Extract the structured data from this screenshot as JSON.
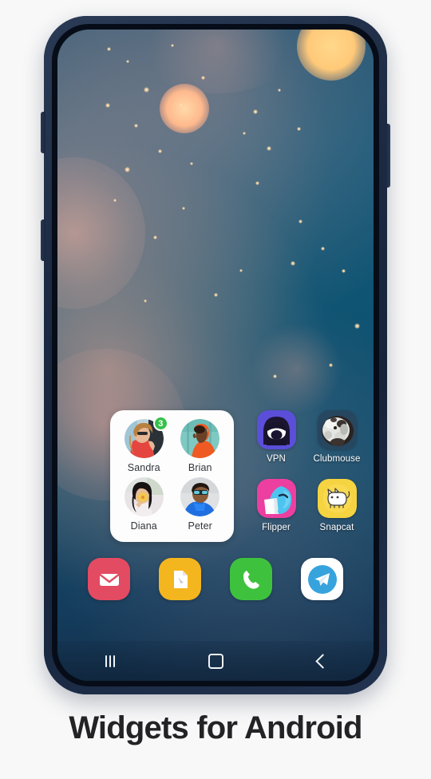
{
  "caption": {
    "text": "Widgets for Android"
  },
  "theme": {
    "page_background": "#f8f8f8",
    "phone_frame": "#1c2a43",
    "wallpaper_base": "#11506f",
    "badge_green": "#35c14a",
    "caption_color": "#232326",
    "widget_card": "#fdfdfd"
  },
  "phone": {
    "buttons": [
      {
        "name": "volume-up-button"
      },
      {
        "name": "volume-down-button"
      },
      {
        "name": "power-button"
      }
    ]
  },
  "home_screen": {
    "contacts_widget": {
      "name": "contacts-widget",
      "contacts": [
        {
          "name": "Sandra",
          "badge": "3",
          "badge_color": "#35c14a",
          "photo": "woman-sunglasses-red-dress"
        },
        {
          "name": "Brian",
          "badge": "",
          "badge_color": "",
          "photo": "man-orange-hoodie-profile"
        },
        {
          "name": "Diana",
          "badge": "",
          "badge_color": "",
          "photo": "woman-dark-hair-yellow-flower"
        },
        {
          "name": "Peter",
          "badge": "",
          "badge_color": "",
          "photo": "man-sunglasses-blue-jacket"
        }
      ]
    },
    "apps": [
      {
        "label": "VPN",
        "icon": "vpn-mask-icon",
        "bg": "#5b4ed8"
      },
      {
        "label": "Clubmouse",
        "icon": "clubmouse-photo-icon",
        "bg": "#2a4760"
      },
      {
        "label": "Flipper",
        "icon": "flipper-dolphin-icon",
        "bg": "#ec3fa0"
      },
      {
        "label": "Snapcat",
        "icon": "snapcat-cat-icon",
        "bg": "#f5d341"
      }
    ],
    "dock": [
      {
        "label": "Mail",
        "icon": "mail-envelope-icon",
        "bg": "#e34b62"
      },
      {
        "label": "Files",
        "icon": "document-file-icon",
        "bg": "#f4b61e"
      },
      {
        "label": "Phone",
        "icon": "phone-handset-icon",
        "bg": "#3ec23e"
      },
      {
        "label": "Telegram",
        "icon": "telegram-plane-icon",
        "bg": "#ffffff"
      }
    ],
    "navigation_bar": [
      {
        "label": "Recents",
        "icon": "recents-bars-icon"
      },
      {
        "label": "Home",
        "icon": "home-square-icon"
      },
      {
        "label": "Back",
        "icon": "back-chevron-icon"
      }
    ]
  }
}
